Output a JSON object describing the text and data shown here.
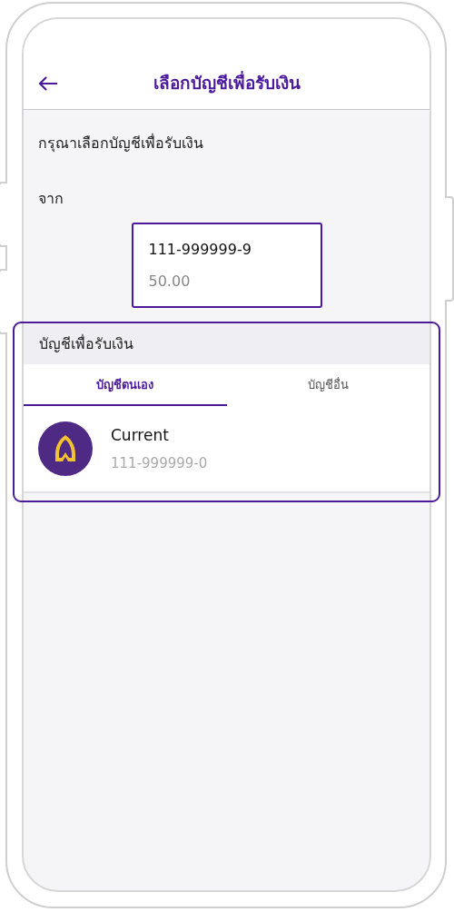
{
  "header": {
    "title": "เลือกบัญชีเพื่อรับเงิน"
  },
  "prompt": "กรุณาเลือกบัญชีเพื่อรับเงิน",
  "from_label": "จาก",
  "source_account": {
    "number": "111-999999-9",
    "amount": "50.00"
  },
  "receive_section": {
    "title": "บัญชีเพื่อรับเงิน",
    "tabs": [
      {
        "label": "บัญชีตนเอง",
        "selected": true
      },
      {
        "label": "บัญชีอื่น",
        "selected": false
      }
    ],
    "accounts": [
      {
        "name": "Current",
        "number": "111-999999-0"
      }
    ]
  }
}
